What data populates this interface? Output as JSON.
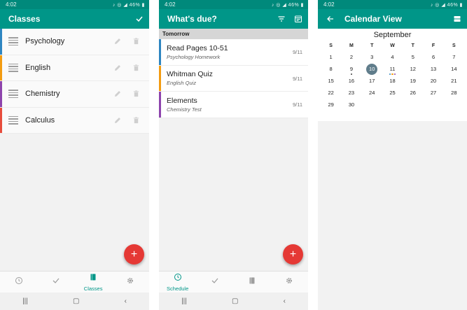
{
  "status": {
    "time": "4:02",
    "indicators": "♪ ◎ ◢ 46% ▮"
  },
  "classes_screen": {
    "title": "Classes",
    "confirm_icon": "check-icon",
    "classes": [
      {
        "name": "Psychology",
        "color": "#2e86c1"
      },
      {
        "name": "English",
        "color": "#f39c12"
      },
      {
        "name": "Chemistry",
        "color": "#8e44ad"
      },
      {
        "name": "Calculus",
        "color": "#e74c3c"
      }
    ],
    "fab_label": "+",
    "nav": [
      {
        "label": "",
        "icon": "clock-icon",
        "active": false
      },
      {
        "label": "",
        "icon": "check-icon",
        "active": false
      },
      {
        "label": "Classes",
        "icon": "book-icon",
        "active": true
      },
      {
        "label": "",
        "icon": "gear-icon",
        "active": false
      }
    ]
  },
  "due_screen": {
    "title": "What's due?",
    "section": "Tomorrow",
    "items": [
      {
        "title": "Read Pages 10-51",
        "subtitle": "Psychology Homework",
        "date": "9/11",
        "color": "#2e86c1"
      },
      {
        "title": "Whitman Quiz",
        "subtitle": "English Quiz",
        "date": "9/11",
        "color": "#f39c12"
      },
      {
        "title": "Elements",
        "subtitle": "Chemistry Test",
        "date": "9/11",
        "color": "#8e44ad"
      }
    ],
    "fab_label": "+",
    "nav": [
      {
        "label": "Schedule",
        "icon": "clock-icon",
        "active": true
      },
      {
        "label": "",
        "icon": "check-icon",
        "active": false
      },
      {
        "label": "",
        "icon": "book-icon",
        "active": false
      },
      {
        "label": "",
        "icon": "gear-icon",
        "active": false
      }
    ]
  },
  "calendar_screen": {
    "title": "Calendar View",
    "month": "September",
    "weekdays": [
      "S",
      "M",
      "T",
      "W",
      "T",
      "F",
      "S"
    ],
    "start_offset": 0,
    "days": 30,
    "selected_day": 10,
    "event_dots": {
      "9": [
        "#424242"
      ],
      "11": [
        "#2e86c1",
        "#f39c12",
        "#8e44ad"
      ]
    }
  },
  "colors": {
    "primary": "#009688",
    "status_bar": "#00897b",
    "accent": "#e53935",
    "selected_day": "#607d8b"
  }
}
